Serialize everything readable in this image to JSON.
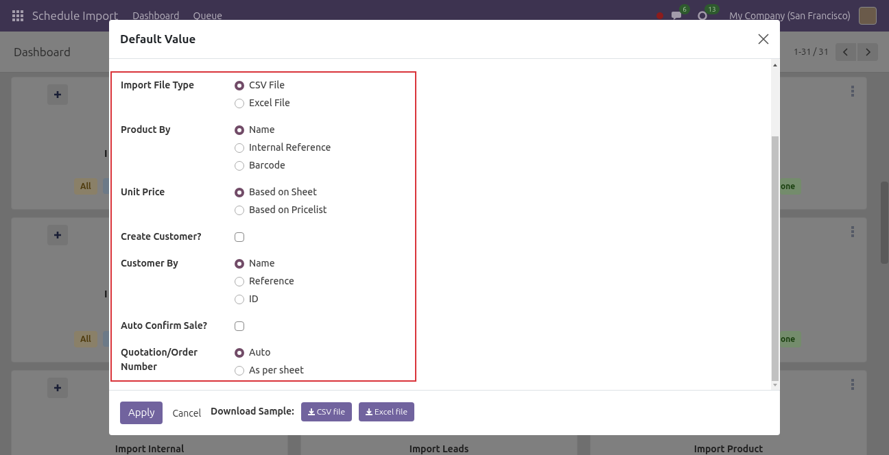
{
  "navbar": {
    "app_name": "Schedule Import",
    "menu": [
      "Dashboard",
      "Queue"
    ],
    "chat_count": "6",
    "activity_count": "13",
    "company": "My Company (San Francisco)"
  },
  "control_panel": {
    "title": "Dashboard",
    "pager": "1-31 / 31"
  },
  "card_rows": [
    {
      "left": {
        "title": "I",
        "badge": "All"
      },
      "right": {
        "badge": "one"
      }
    },
    {
      "left": {
        "title": "I",
        "badge": "All"
      },
      "right": {
        "badge": "one"
      }
    },
    {
      "titles": [
        "Import Internal",
        "Import Leads",
        "Import Product"
      ]
    }
  ],
  "dialog": {
    "title": "Default Value",
    "fields": [
      {
        "kind": "radio",
        "label": "Import File Type",
        "options": [
          {
            "label": "CSV File",
            "selected": true
          },
          {
            "label": "Excel File",
            "selected": false
          }
        ]
      },
      {
        "kind": "radio",
        "label": "Product By",
        "options": [
          {
            "label": "Name",
            "selected": true
          },
          {
            "label": "Internal Reference",
            "selected": false
          },
          {
            "label": "Barcode",
            "selected": false
          }
        ]
      },
      {
        "kind": "radio",
        "label": "Unit Price",
        "options": [
          {
            "label": "Based on Sheet",
            "selected": true
          },
          {
            "label": "Based on Pricelist",
            "selected": false
          }
        ]
      },
      {
        "kind": "checkbox",
        "label": "Create Customer?",
        "checked": false
      },
      {
        "kind": "radio",
        "label": "Customer By",
        "options": [
          {
            "label": "Name",
            "selected": true
          },
          {
            "label": "Reference",
            "selected": false
          },
          {
            "label": "ID",
            "selected": false
          }
        ]
      },
      {
        "kind": "checkbox",
        "label": "Auto Confirm Sale?",
        "checked": false
      },
      {
        "kind": "radio",
        "label": "Quotation/Order Number",
        "options": [
          {
            "label": "Auto",
            "selected": true
          },
          {
            "label": "As per sheet",
            "selected": false
          }
        ]
      }
    ],
    "footer": {
      "apply": "Apply",
      "cancel": "Cancel",
      "download_label": "Download Sample:",
      "downloads": [
        "CSV file",
        "Excel file"
      ]
    }
  }
}
